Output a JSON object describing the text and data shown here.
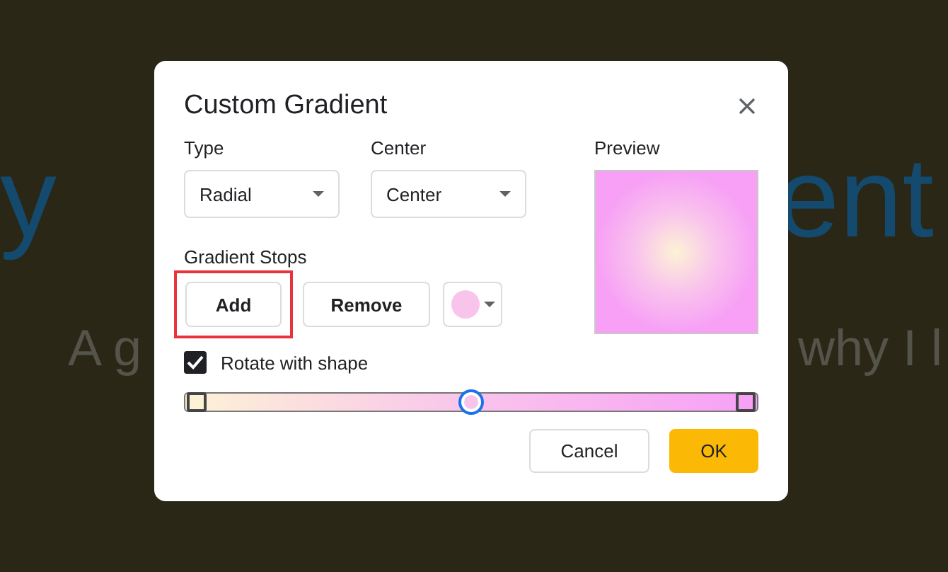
{
  "background": {
    "title_left": "y",
    "title_right": "ent",
    "subtitle_left": "A g",
    "subtitle_right": "why I l"
  },
  "dialog": {
    "title": "Custom Gradient",
    "type": {
      "label": "Type",
      "value": "Radial"
    },
    "center": {
      "label": "Center",
      "value": "Center"
    },
    "preview": {
      "label": "Preview"
    },
    "gradient_stops": {
      "label": "Gradient Stops",
      "add_button": {
        "label": "Add",
        "highlighted": true
      },
      "remove_button": {
        "label": "Remove",
        "highlighted": false
      }
    },
    "rotate_with_shape": {
      "label": "Rotate with shape",
      "checked": true
    },
    "stops": [
      {
        "level": 0,
        "color": "#fdf2d6",
        "selected": false
      },
      {
        "level": 0.5,
        "color": "#f9c4ec",
        "selected": true
      },
      {
        "level": 1,
        "color": "#f7a0f6",
        "selected": false
      }
    ],
    "buttons": {
      "cancel": "Cancel",
      "ok": "OK"
    }
  }
}
